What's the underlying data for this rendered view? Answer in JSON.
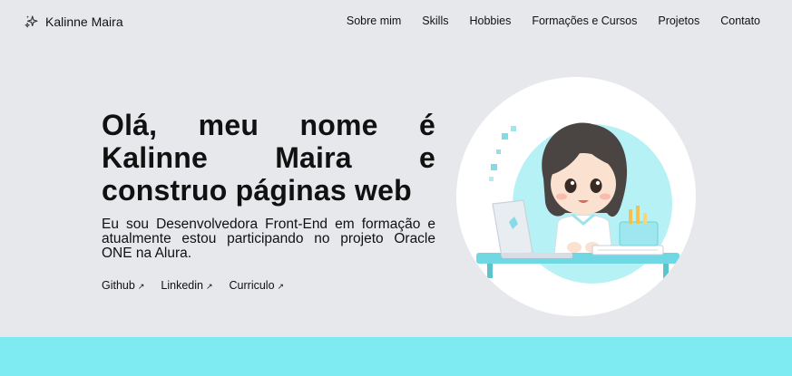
{
  "brand": {
    "name": "Kalinne Maira",
    "icon": "sparkle-icon"
  },
  "nav": [
    {
      "label": "Sobre mim"
    },
    {
      "label": "Skills"
    },
    {
      "label": "Hobbies"
    },
    {
      "label": "Formações e Cursos"
    },
    {
      "label": "Projetos"
    },
    {
      "label": "Contato"
    }
  ],
  "hero": {
    "headline_lines": [
      "Olá, meu nome é",
      "Kalinne Maira e",
      "construo páginas web"
    ],
    "lead": "Eu sou Desenvolvedora Front-End em formação e atualmente estou participando no projeto Oracle ONE na Alura.",
    "links": [
      {
        "label": "Github",
        "icon": "arrow-up-right-icon"
      },
      {
        "label": "Linkedin",
        "icon": "arrow-up-right-icon"
      },
      {
        "label": "Curriculo",
        "icon": "arrow-up-right-icon"
      }
    ]
  },
  "colors": {
    "background": "#e6e8ec",
    "accent": "#7eeaf1",
    "text": "#111111"
  }
}
